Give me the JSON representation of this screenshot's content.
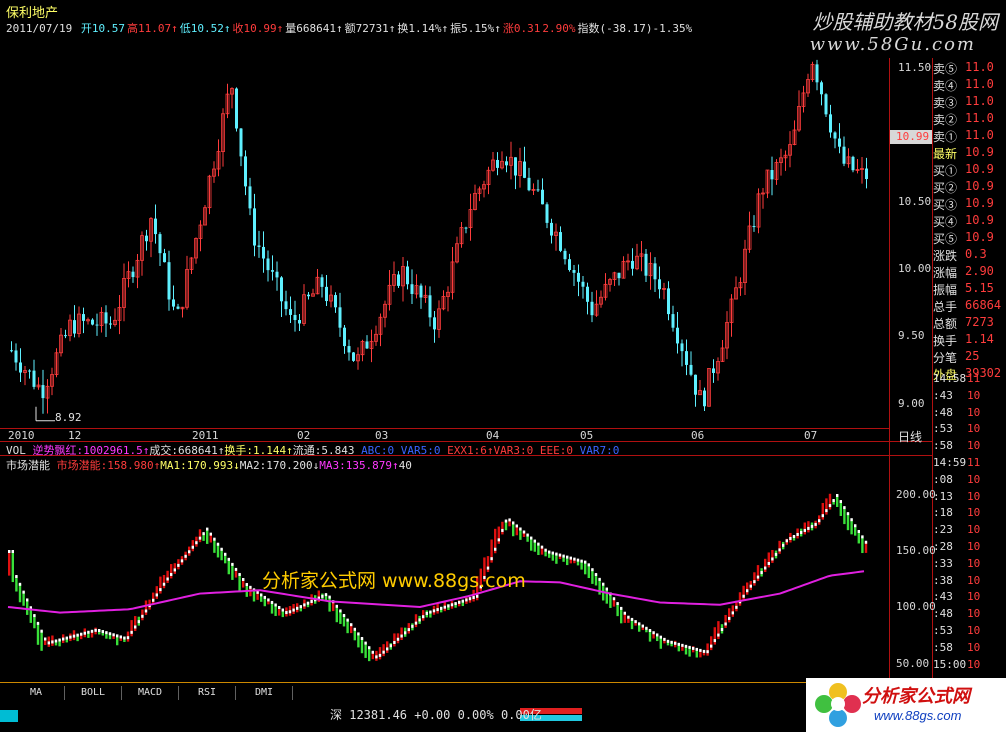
{
  "header": {
    "stock_name": "保利地产",
    "date": "2011/07/19",
    "quote": [
      {
        "label": "开",
        "value": "10.57",
        "cls": "c"
      },
      {
        "label": "高",
        "value": "11.07",
        "cls": "r",
        "arrow": "↑"
      },
      {
        "label": "低",
        "value": "10.52",
        "cls": "c",
        "arrow": "↑"
      },
      {
        "label": "收",
        "value": "10.99",
        "cls": "r",
        "arrow": "↑"
      },
      {
        "label": "量",
        "value": "668641",
        "cls": "w",
        "arrow": "↑"
      },
      {
        "label": "额",
        "value": "72731",
        "cls": "w",
        "arrow": "↑"
      },
      {
        "label": "换",
        "value": "1.14%",
        "cls": "w",
        "arrow": "↑"
      },
      {
        "label": "振",
        "value": "5.15%",
        "cls": "w",
        "arrow": "↑"
      },
      {
        "label": "涨",
        "value": "0.31",
        "cls": "r"
      },
      {
        "label": "",
        "value": "2.90%",
        "cls": "r"
      },
      {
        "label": "指数",
        "value": "(-38.17)-1.35%",
        "cls": "w"
      }
    ],
    "watermark_title": "炒股辅助教材58股网",
    "watermark_url": "www.58Gu.com"
  },
  "price_axis": {
    "ticks": [
      "11.50",
      "11.00",
      "10.50",
      "10.00",
      "9.50",
      "9.00"
    ],
    "current_price": "10.99",
    "low_mark": "8.92"
  },
  "x_axis": {
    "labels": [
      "2010",
      "12",
      "2011",
      "02",
      "03",
      "04",
      "05",
      "06",
      "07"
    ],
    "period": "日线"
  },
  "order_book": [
    {
      "label": "卖⑤",
      "value": "11.0"
    },
    {
      "label": "卖④",
      "value": "11.0"
    },
    {
      "label": "卖③",
      "value": "11.0"
    },
    {
      "label": "卖②",
      "value": "11.0"
    },
    {
      "label": "卖①",
      "value": "11.0"
    },
    {
      "label": "最新",
      "value": "10.9"
    },
    {
      "label": "买①",
      "value": "10.9"
    },
    {
      "label": "买②",
      "value": "10.9"
    },
    {
      "label": "买③",
      "value": "10.9"
    },
    {
      "label": "买④",
      "value": "10.9"
    },
    {
      "label": "买⑤",
      "value": "10.9"
    },
    {
      "label": "涨跌",
      "value": "0.3"
    },
    {
      "label": "涨幅",
      "value": "2.90"
    },
    {
      "label": "振幅",
      "value": "5.15"
    },
    {
      "label": "总手",
      "value": "66864"
    },
    {
      "label": "总额",
      "value": "7273"
    },
    {
      "label": "换手",
      "value": "1.14"
    },
    {
      "label": "分笔",
      "value": "25"
    },
    {
      "label": "外盘",
      "value": "39302"
    }
  ],
  "ticks_panel": [
    {
      "t": "14:58",
      "v": "11"
    },
    {
      "t": ":43",
      "v": "10"
    },
    {
      "t": ":48",
      "v": "10"
    },
    {
      "t": ":53",
      "v": "10"
    },
    {
      "t": ":58",
      "v": "10"
    },
    {
      "t": "14:59",
      "v": "11"
    },
    {
      "t": ":08",
      "v": "10"
    },
    {
      "t": ":13",
      "v": "10"
    },
    {
      "t": ":18",
      "v": "10"
    },
    {
      "t": ":23",
      "v": "10"
    },
    {
      "t": ":28",
      "v": "10"
    },
    {
      "t": ":33",
      "v": "10"
    },
    {
      "t": ":38",
      "v": "10"
    },
    {
      "t": ":43",
      "v": "10"
    },
    {
      "t": ":48",
      "v": "10"
    },
    {
      "t": ":53",
      "v": "10"
    },
    {
      "t": ":58",
      "v": "10"
    },
    {
      "t": "15:00",
      "v": "10"
    }
  ],
  "vol_legend": "VOL  逆势飘红:1002961.5↑成交:668641↑换手:1.144↑流通:5.843  ...",
  "indicator": {
    "name": "市场潜能",
    "line": "市场潜能:158.980↑MA1:170.993↓MA2:170.200↓MA3:135.879↑40",
    "ticks": [
      "200.00",
      "150.00",
      "100.00",
      "50.00"
    ]
  },
  "tabs": [
    "MA",
    "BOLL",
    "MACD",
    "RSI",
    "DMI"
  ],
  "status": "深 12381.46 +0.00 0.00% 0.00亿",
  "mid_watermark": "分析家公式网 www.88gs.com",
  "brand": {
    "name": "分析家公式网",
    "url": "www.88gs.com"
  },
  "colors": {
    "up": "#ff3c3c",
    "down": "#5ff0ff",
    "ma3": "#e020e0",
    "axis": "#b01010"
  }
}
